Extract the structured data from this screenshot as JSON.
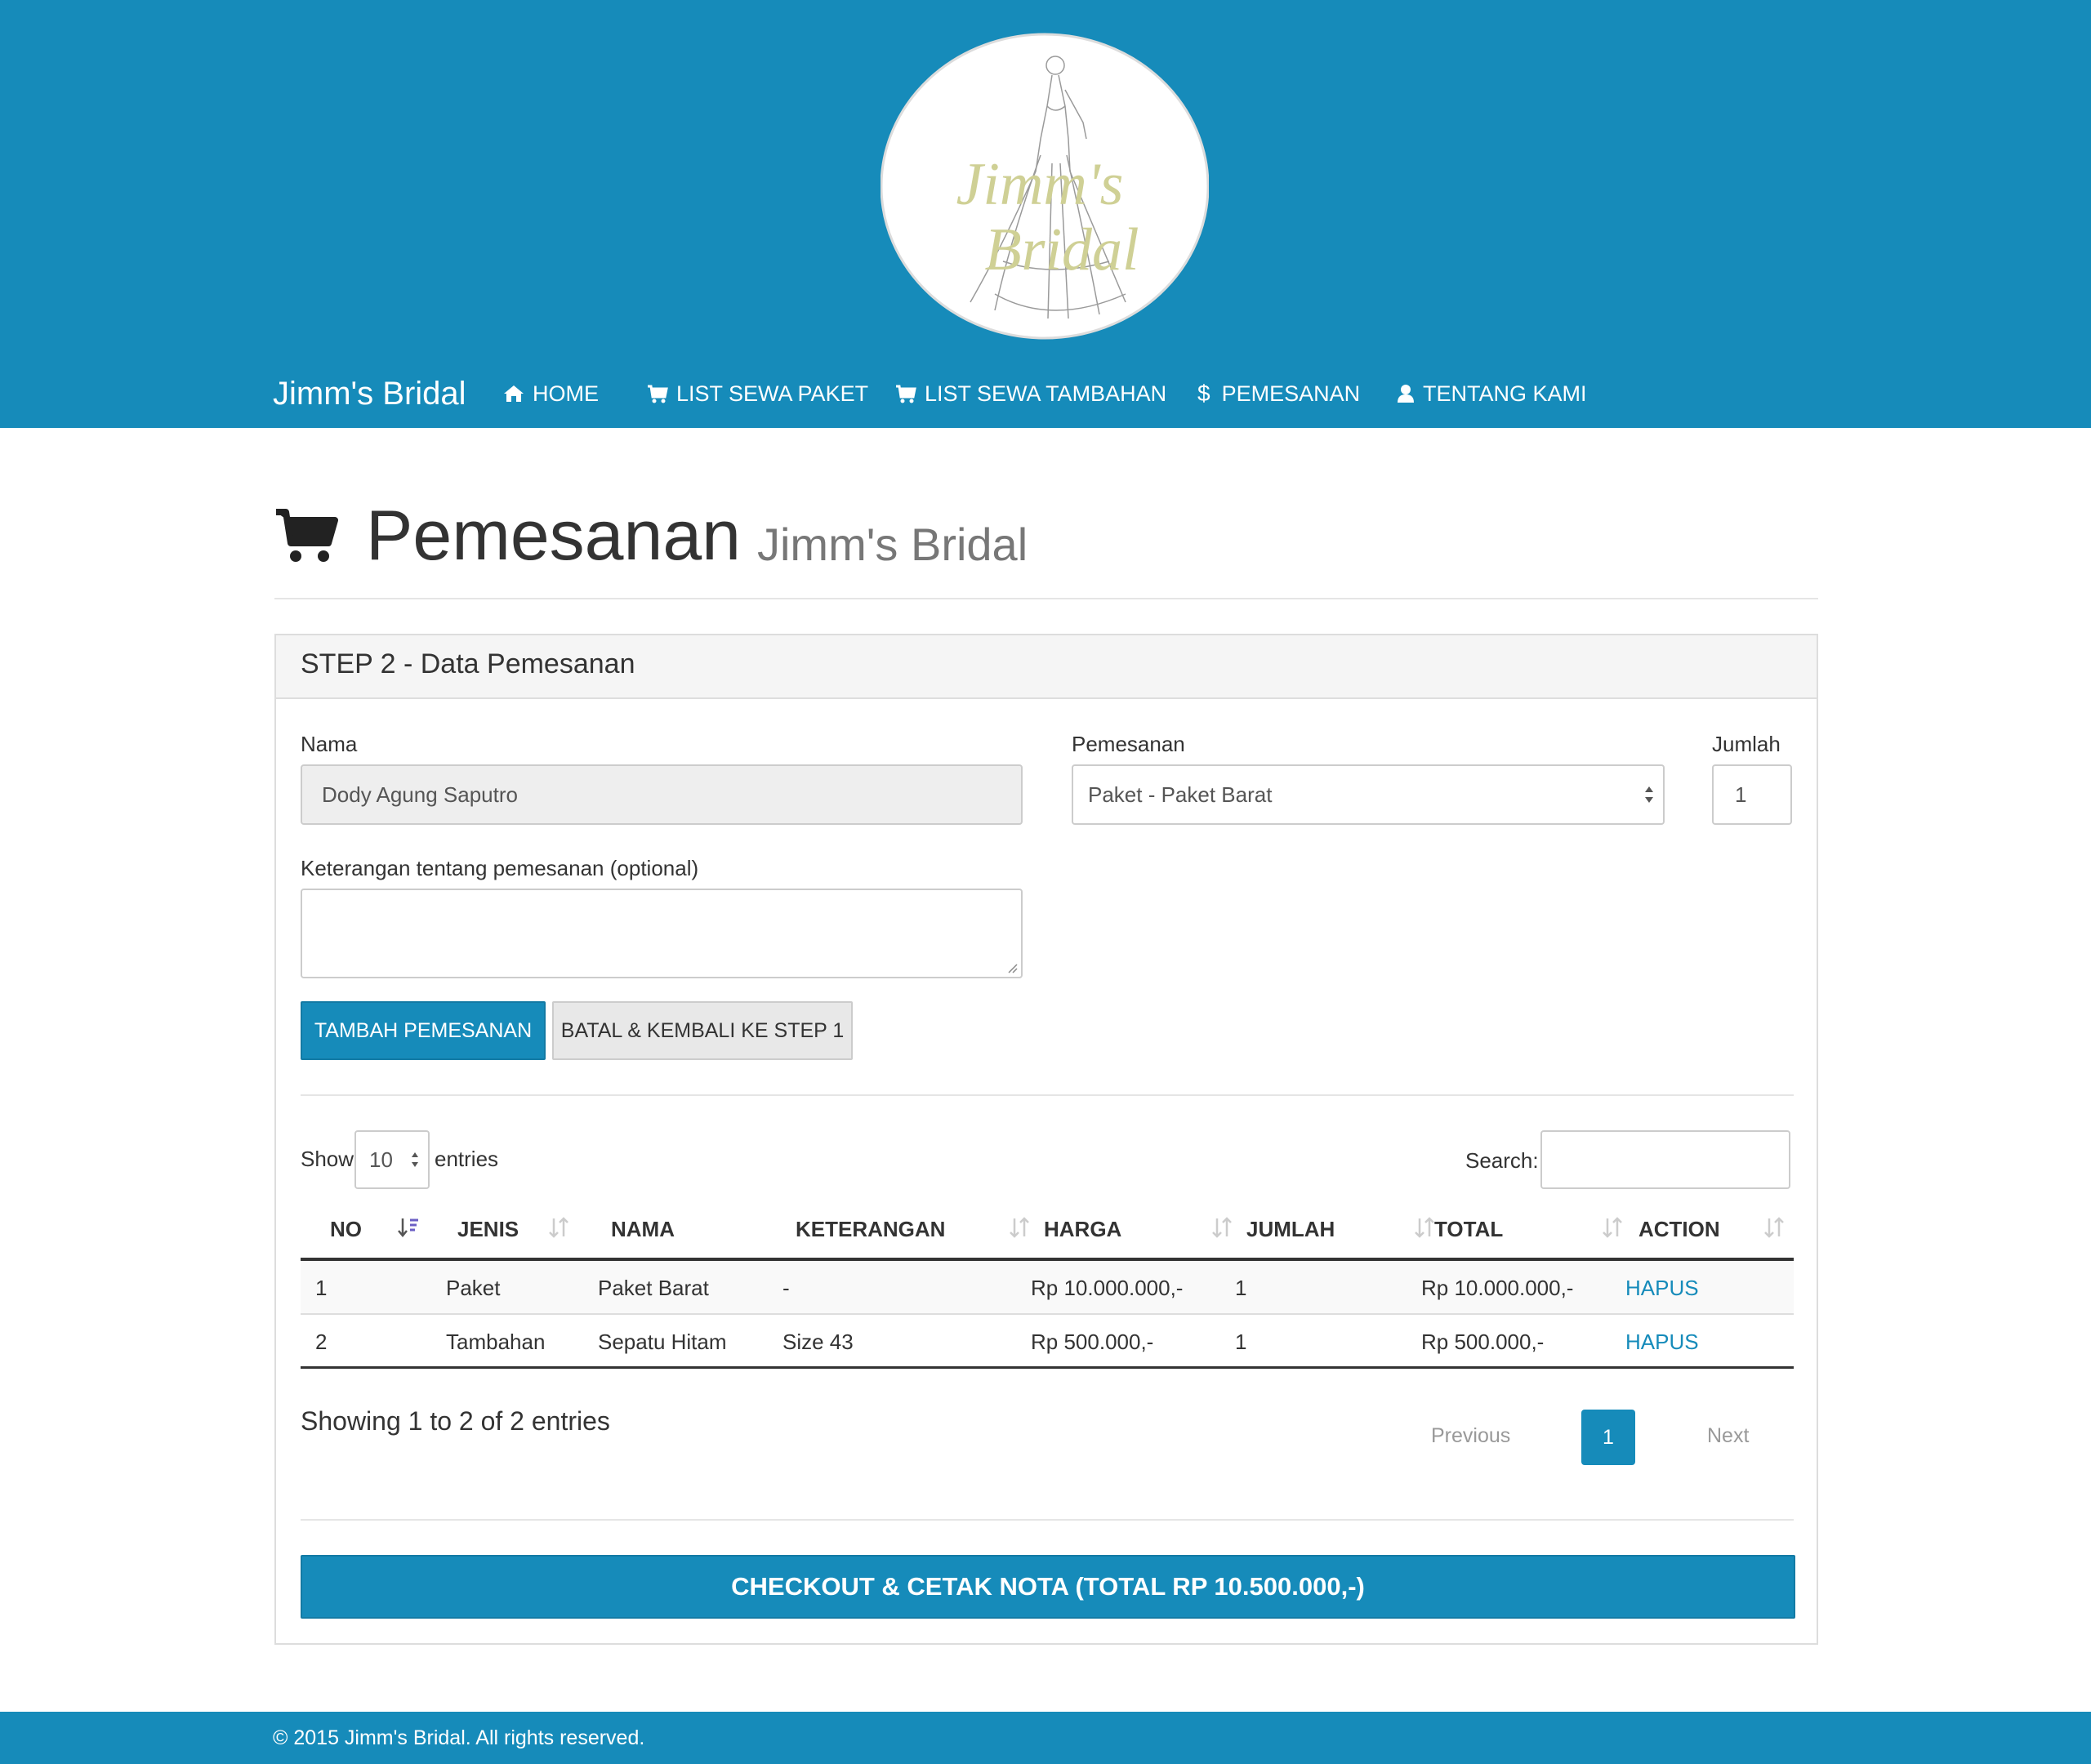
{
  "header": {
    "logo_line1": "Jimm's",
    "logo_line2": "Bridal",
    "brand": "Jimm's Bridal",
    "nav": [
      {
        "label": "HOME",
        "icon": "home-icon"
      },
      {
        "label": "LIST SEWA PAKET",
        "icon": "cart-icon"
      },
      {
        "label": "LIST SEWA TAMBAHAN",
        "icon": "cart-icon"
      },
      {
        "label": "PEMESANAN",
        "icon": "dollar-icon"
      },
      {
        "label": "TENTANG KAMI",
        "icon": "user-icon"
      }
    ]
  },
  "page": {
    "title": "Pemesanan",
    "subtitle": "Jimm's Bridal"
  },
  "panel": {
    "title": "STEP 2 - Data Pemesanan",
    "nama_label": "Nama",
    "nama_value": "Dody Agung Saputro",
    "pemesanan_label": "Pemesanan",
    "pemesanan_value": "Paket - Paket Barat",
    "jumlah_label": "Jumlah",
    "jumlah_value": "1",
    "keterangan_label": "Keterangan tentang pemesanan (optional)",
    "keterangan_value": "",
    "btn_tambah": "TAMBAH PEMESANAN",
    "btn_batal": "BATAL & KEMBALI KE STEP 1"
  },
  "table": {
    "show_label": "Show",
    "show_value": "10",
    "entries_label": "entries",
    "search_label": "Search:",
    "search_value": "",
    "columns": [
      "NO",
      "JENIS",
      "NAMA",
      "KETERANGAN",
      "HARGA",
      "JUMLAH",
      "TOTAL",
      "ACTION"
    ],
    "rows": [
      {
        "no": "1",
        "jenis": "Paket",
        "nama": "Paket Barat",
        "keterangan": "-",
        "harga": "Rp 10.000.000,-",
        "jumlah": "1",
        "total": "Rp 10.000.000,-",
        "action": "HAPUS"
      },
      {
        "no": "2",
        "jenis": "Tambahan",
        "nama": "Sepatu Hitam",
        "keterangan": "Size 43",
        "harga": "Rp 500.000,-",
        "jumlah": "1",
        "total": "Rp 500.000,-",
        "action": "HAPUS"
      }
    ],
    "info": "Showing 1 to 2 of 2 entries",
    "prev": "Previous",
    "current_page": "1",
    "next": "Next"
  },
  "checkout": "CHECKOUT & CETAK NOTA (TOTAL RP 10.500.000,-)",
  "footer": "© 2015 Jimm's Bridal. All rights reserved.",
  "colors": {
    "primary": "#168bba",
    "link": "#168bba"
  }
}
